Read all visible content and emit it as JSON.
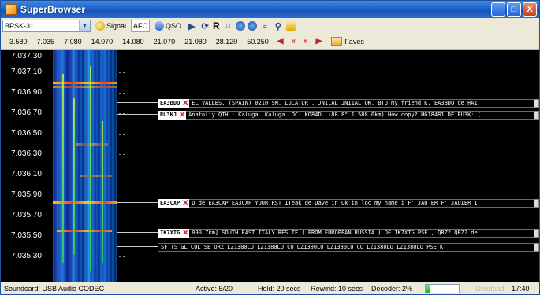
{
  "window": {
    "title": "SuperBrowser",
    "min_label": "_",
    "max_label": "□",
    "close_label": "X"
  },
  "toolbar": {
    "mode_value": "BPSK-31",
    "signal_label": "Signal",
    "afc_label": "AFC",
    "qso_label": "QSO",
    "r_label": "R"
  },
  "bands": {
    "frequencies": [
      "3.580",
      "7.035",
      "7.080",
      "14.070",
      "14.080",
      "21.070",
      "21.080",
      "28.120",
      "50.250"
    ],
    "faves_label": "Faves"
  },
  "axis": {
    "labels": [
      "7.037.30",
      "7.037.10",
      "7.036.90",
      "7.036.70",
      "7.036.50",
      "7.036.30",
      "7.036.10",
      "7.035.90",
      "7.035.70",
      "7.035.50",
      "7.035.30"
    ]
  },
  "messages": [
    {
      "callsign": "EA3BDQ",
      "text": "EL VALLES. (SPAIN) 0210 SM. LOCATOR . JN11AL JN11AL OK. BTU my friend K. EA3BDQ de RA1"
    },
    {
      "callsign": "RU3KJ",
      "text": "Anatoliy QTH : Kaluga. Kaluga LOC: KO84DL (88.8\" 1.588.0km) How copy? HG18481 DE RU3K: ("
    },
    {
      "callsign": "EA3CXP",
      "text": "D de EA3CXP EA3CXP YOUR RST 1Teak de Dave in Uk in loc my name i F' JAU ER F' JAUIER I"
    },
    {
      "callsign": "IK7XTG",
      "text": "090.7km] SOUTH EAST ITALY RESLTE ( FROM EUROPEAN RUSSIA ) DE IK7XTG PSE , QRZ? QRZ? de"
    },
    {
      "callsign": "",
      "text": "SF TS GL CUL SE QRZ LZ1380LO LZ1380LO CQ LZ1380LO LZ1380LO CQ LZ1380LO LZ1380LO PSE K"
    }
  ],
  "statusbar": {
    "soundcard": "Soundcard: USB Audio CODEC",
    "active": "Active: 5/20",
    "hold": "Hold: 20 secs",
    "rewind": "Rewind: 10 secs",
    "decoder": "Decoder: 2%",
    "overload": "Overload",
    "time": "17:40",
    "level_fraction": 0.12
  },
  "colors": {
    "titlebar": "#1f62c8",
    "waterfall_base": "#0c3294",
    "signal_hot": "#ff3c1a",
    "close_red": "#e02020"
  }
}
